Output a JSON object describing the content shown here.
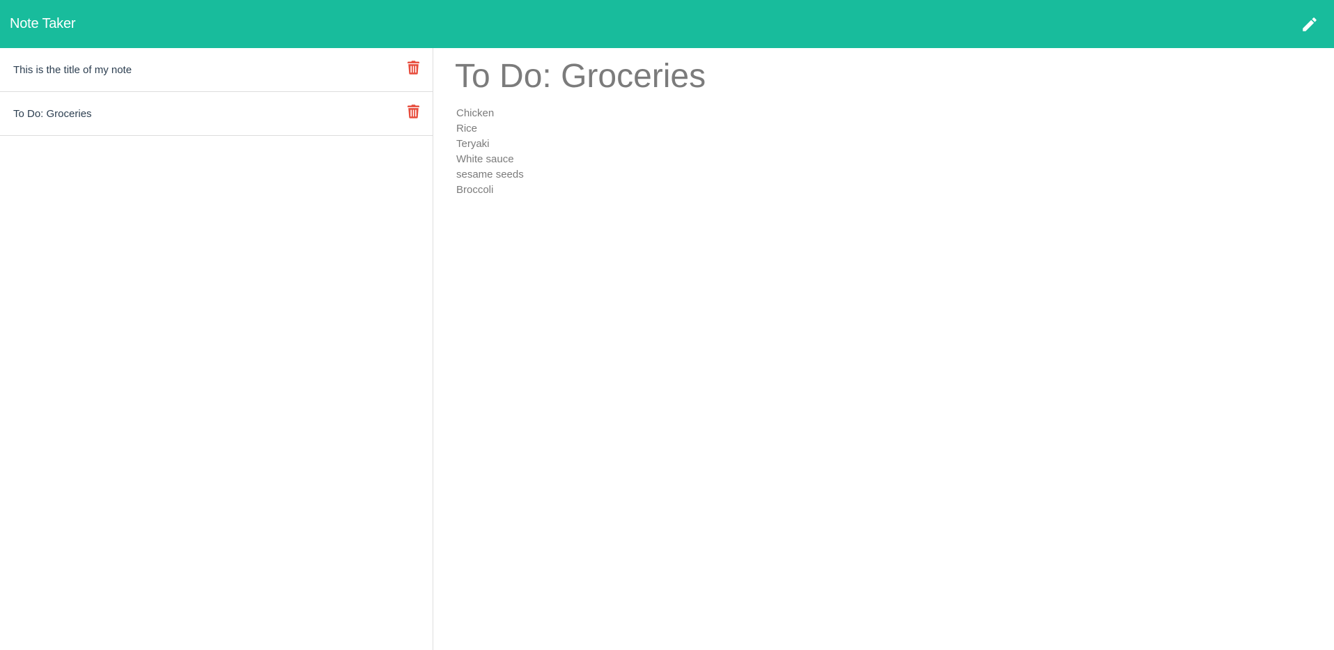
{
  "app": {
    "title": "Note Taker"
  },
  "header": {
    "new_note_icon": "pencil-icon"
  },
  "colors": {
    "navbar": "#18bc9c",
    "delete": "#e74c3c",
    "text_muted": "#7b7b7b"
  },
  "notes": [
    {
      "title": "This is the title of my note",
      "delete_icon": "trash-icon"
    },
    {
      "title": "To Do: Groceries",
      "delete_icon": "trash-icon"
    }
  ],
  "active_note": {
    "title": "To Do: Groceries",
    "lines": [
      "Chicken",
      "Rice",
      "Teryaki",
      "White sauce",
      "sesame seeds",
      "Broccoli"
    ]
  }
}
